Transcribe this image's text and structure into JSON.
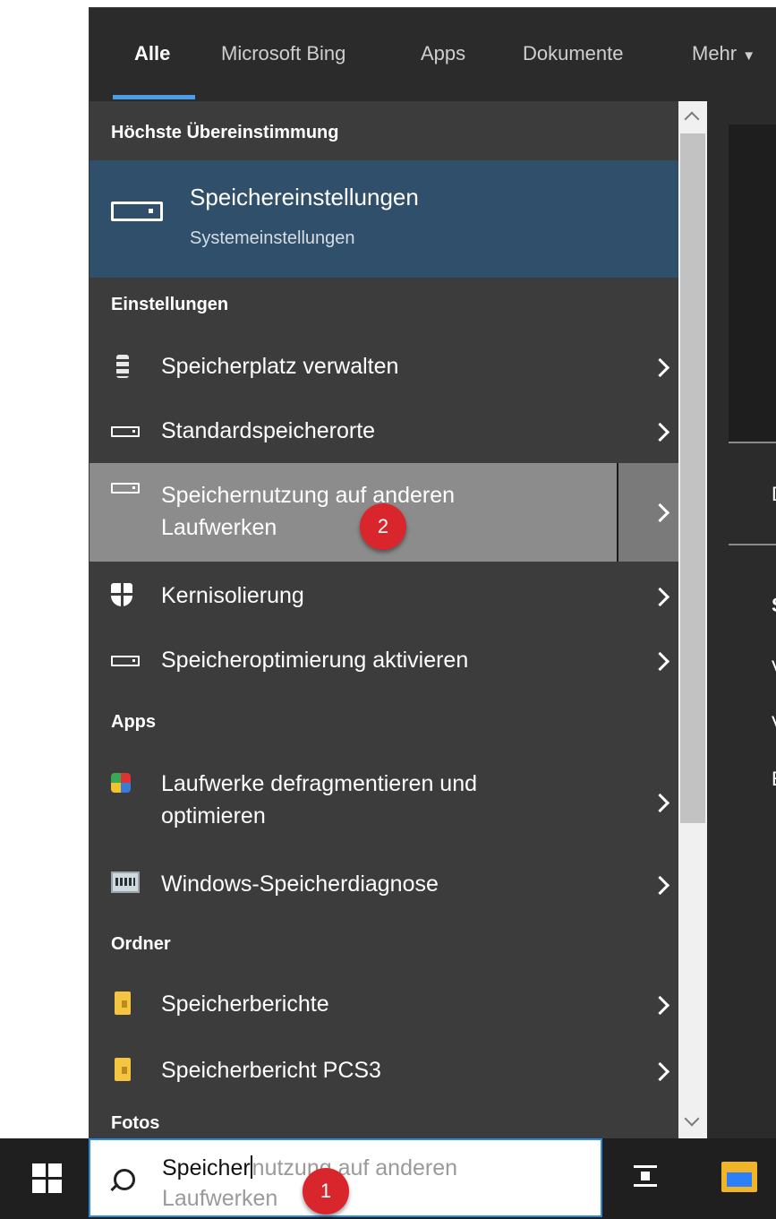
{
  "tabs": [
    {
      "label": "Alle",
      "active": true
    },
    {
      "label": "Microsoft Bing",
      "active": false
    },
    {
      "label": "Apps",
      "active": false
    },
    {
      "label": "Dokumente",
      "active": false
    },
    {
      "label": "Mehr",
      "active": false
    }
  ],
  "sections": {
    "best_match": "Höchste Übereinstimmung",
    "settings": "Einstellungen",
    "apps": "Apps",
    "folders": "Ordner",
    "photos": "Fotos"
  },
  "best_match": {
    "title": "Speichereinstellungen",
    "subtitle": "Systemeinstellungen",
    "icon": "drive-icon"
  },
  "settings_items": [
    {
      "label": "Speicherplatz verwalten",
      "icon": "storage-icon"
    },
    {
      "label": "Standardspeicherorte",
      "icon": "drive-icon"
    },
    {
      "label": "Speichernutzung auf anderen Laufwerken",
      "icon": "drive-icon"
    },
    {
      "label": "Kernisolierung",
      "icon": "shield-icon"
    },
    {
      "label": "Speicheroptimierung aktivieren",
      "icon": "drive-icon"
    }
  ],
  "app_items": [
    {
      "label": "Laufwerke defragmentieren und optimieren",
      "icon": "defrag-icon"
    },
    {
      "label": "Windows-Speicherdiagnose",
      "icon": "memory-diagnostic-icon"
    }
  ],
  "folder_items": [
    {
      "label": "Speicherberichte",
      "icon": "folder-icon"
    },
    {
      "label": "Speicherbericht PCS3",
      "icon": "folder-icon"
    }
  ],
  "preview": {
    "chars": [
      "D",
      "S",
      "V",
      "V",
      "E"
    ]
  },
  "badges": {
    "one": "1",
    "two": "2"
  },
  "search": {
    "typed": "Speicher",
    "suggestion": "nutzung auf anderen Laufwerken"
  },
  "colors": {
    "accent": "#4a9ee8",
    "selected_bg": "#2f4f6b",
    "hover_bg": "#8c8c8c",
    "badge": "#d8262c"
  }
}
